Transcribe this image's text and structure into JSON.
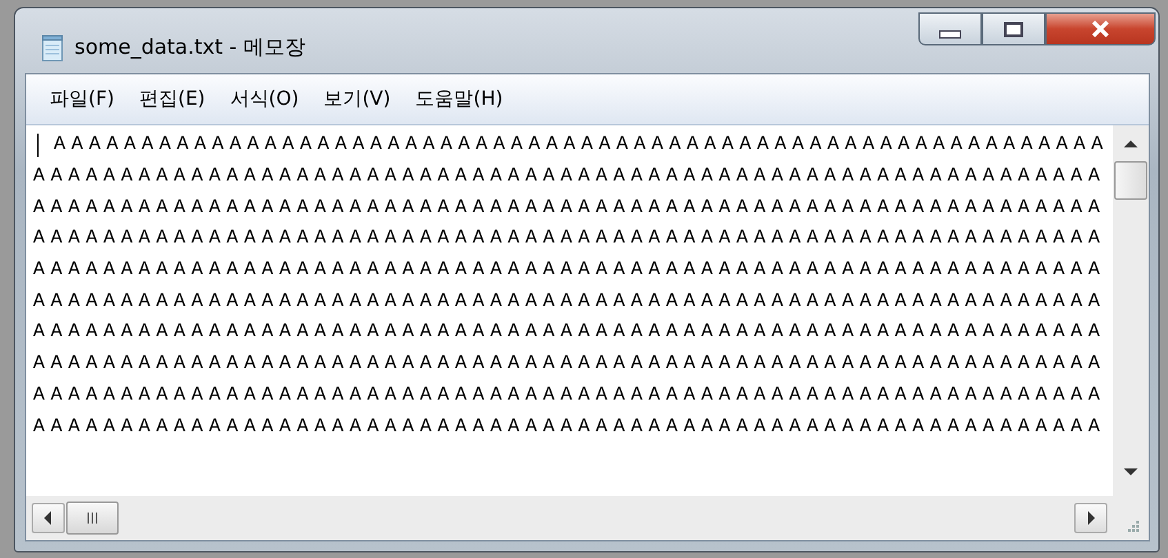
{
  "window": {
    "title": "some_data.txt - 메모장"
  },
  "menu": [
    "파일(F)",
    "편집(E)",
    "서식(O)",
    "보기(V)",
    "도움말(H)"
  ],
  "lines": [
    {
      "text": "AAAAAAAAAAAAAAAAAAAAAAAAAAAAAAAAAAAAAAAAAAAAAAAAAAAAAAAAAAAA",
      "cursor": true
    },
    {
      "text": "AAAAAAAAAAAAAAAAAAAAAAAAAAAAAAAAAAAAAAAAAAAAAAAAAAAAAAAAAAAAA",
      "cursor": false
    },
    {
      "text": "AAAAAAAAAAAAAAAAAAAAAAAAAAAAAAAAAAAAAAAAAAAAAAAAAAAAAAAAAAAAA",
      "cursor": false
    },
    {
      "text": "AAAAAAAAAAAAAAAAAAAAAAAAAAAAAAAAAAAAAAAAAAAAAAAAAAAAAAAAAAAAA",
      "cursor": false
    },
    {
      "text": "AAAAAAAAAAAAAAAAAAAAAAAAAAAAAAAAAAAAAAAAAAAAAAAAAAAAAAAAAAAAA",
      "cursor": false
    },
    {
      "text": "AAAAAAAAAAAAAAAAAAAAAAAAAAAAAAAAAAAAAAAAAAAAAAAAAAAAAAAAAAAAA",
      "cursor": false
    },
    {
      "text": "AAAAAAAAAAAAAAAAAAAAAAAAAAAAAAAAAAAAAAAAAAAAAAAAAAAAAAAAAAAAA",
      "cursor": false
    },
    {
      "text": "AAAAAAAAAAAAAAAAAAAAAAAAAAAAAAAAAAAAAAAAAAAAAAAAAAAAAAAAAAAAA",
      "cursor": false
    },
    {
      "text": "AAAAAAAAAAAAAAAAAAAAAAAAAAAAAAAAAAAAAAAAAAAAAAAAAAAAAAAAAAAAA",
      "cursor": false
    },
    {
      "text": "AAAAAAAAAAAAAAAAAAAAAAAAAAAAAAAAAAAAAAAAAAAAAAAAAAAAAAAAAAAAA",
      "cursor": false
    }
  ]
}
